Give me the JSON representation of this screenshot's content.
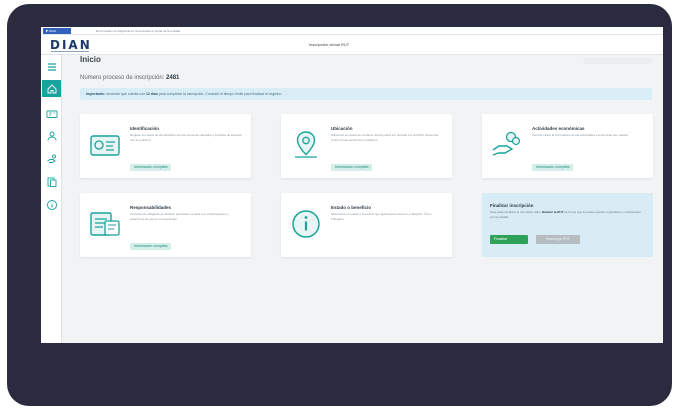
{
  "topbar": {
    "tag": "◤ DIAN",
    "note": "El formulario se diligencia en línea desde el portal de la entidad"
  },
  "header": {
    "logo": "DIAN",
    "title": "Inscripción virtual RUT"
  },
  "sidebar": {
    "items": [
      {
        "icon": "menu-icon"
      },
      {
        "icon": "home-icon"
      },
      {
        "icon": "id-card-icon"
      },
      {
        "icon": "users-icon"
      },
      {
        "icon": "handshake-icon"
      },
      {
        "icon": "documents-icon"
      },
      {
        "icon": "info-icon"
      }
    ]
  },
  "main": {
    "title": "Inicio",
    "process_label": "Número proceso de inscripción:",
    "process_number": "2481",
    "alert": {
      "strong1": "Importante:",
      "text1": "recuerde que cuenta con",
      "strong2": "12 días",
      "text2": "para completar la inscripción. Consulte el tiempo limite para finalizar el registro."
    },
    "cards": [
      {
        "title": "Identificación",
        "desc": "Registre los datos de identificación de las personas naturales o jurídicas de acuerdo con su solicitud.",
        "button": "Información completa",
        "icon": "id-card-icon"
      },
      {
        "title": "Ubicación",
        "desc": "Diligencie los datos de contacto donde podrá ser ubicado por la DIAN. Recuerde incluir correo electrónico y teléfono.",
        "button": "Información completa",
        "icon": "location-pin-icon"
      },
      {
        "title": "Actividades económicas",
        "desc": "Permite incluir la información de las actividades económicas que realiza.",
        "button": "Información completa",
        "icon": "hand-coins-icon"
      },
      {
        "title": "Responsabilidades",
        "desc": "Consulte las obligaciones fiscales que deben cumplir sus contribuyentes y seleccione las que le corresponden.",
        "button": "Información completa",
        "icon": "calendar-document-icon"
      },
      {
        "title": "Estado o beneficio",
        "desc": "Seleccione el estado o beneficio que aplica para usted en el Registro Único Tributario.",
        "button": "",
        "icon": "info-circle-icon"
      }
    ],
    "finish": {
      "title": "Finalizar inscripción",
      "desc_pre": "Para poder finalizar el formulario debe",
      "desc_strong": "finalizar la RUT",
      "desc_post": "de forma que los datos queden registrados y confirmados por la entidad.",
      "button_primary": "Finalizar",
      "button_secondary": "Descargar PDF"
    }
  },
  "colors": {
    "frame": "#2b2b3f",
    "accent": "#19a39c",
    "alert_bg": "#d9edf7",
    "finish_bg": "#d7ecf4",
    "success": "#2fa25a"
  }
}
